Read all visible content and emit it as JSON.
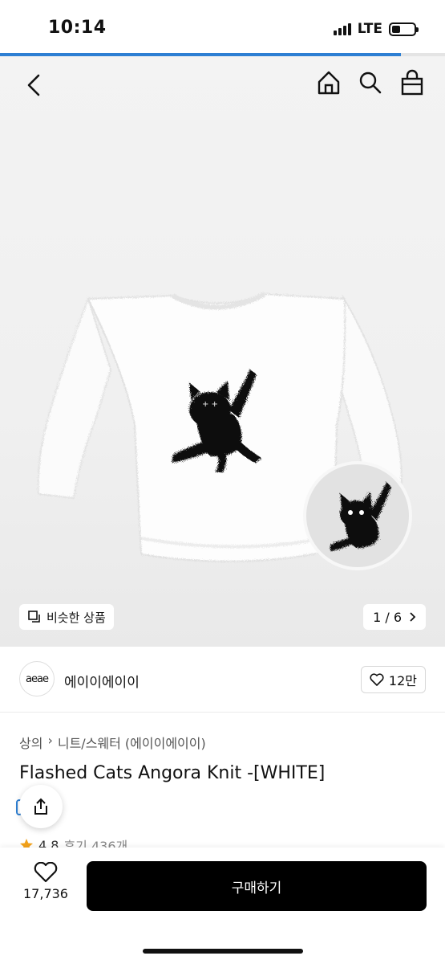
{
  "status_bar": {
    "time": "10:14",
    "network": "LTE",
    "battery_level": 0.4
  },
  "page_load_progress": 0.9,
  "nav": {
    "back_icon": "chevron-left-icon",
    "home_icon": "home-icon",
    "search_icon": "search-icon",
    "cart_icon": "shopping-bag-icon"
  },
  "gallery": {
    "similar_label": "비슷한 상품",
    "page_indicator": "1 / 6"
  },
  "brand": {
    "logo_text": "aeae",
    "name": "에이이에이이",
    "likes": "12만"
  },
  "product": {
    "breadcrumb": [
      "상의",
      "니트/스웨터 (에이이에이이)"
    ],
    "title": "Flashed Cats Angora Knit -[WHITE]",
    "rating": "4.8",
    "reviews": "후기 436개"
  },
  "bottom": {
    "wish_count": "17,736",
    "buy_label": "구매하기"
  },
  "colors": {
    "accent": "#2d7fd3",
    "buy_button": "#000000",
    "star": "#f2a21b"
  }
}
